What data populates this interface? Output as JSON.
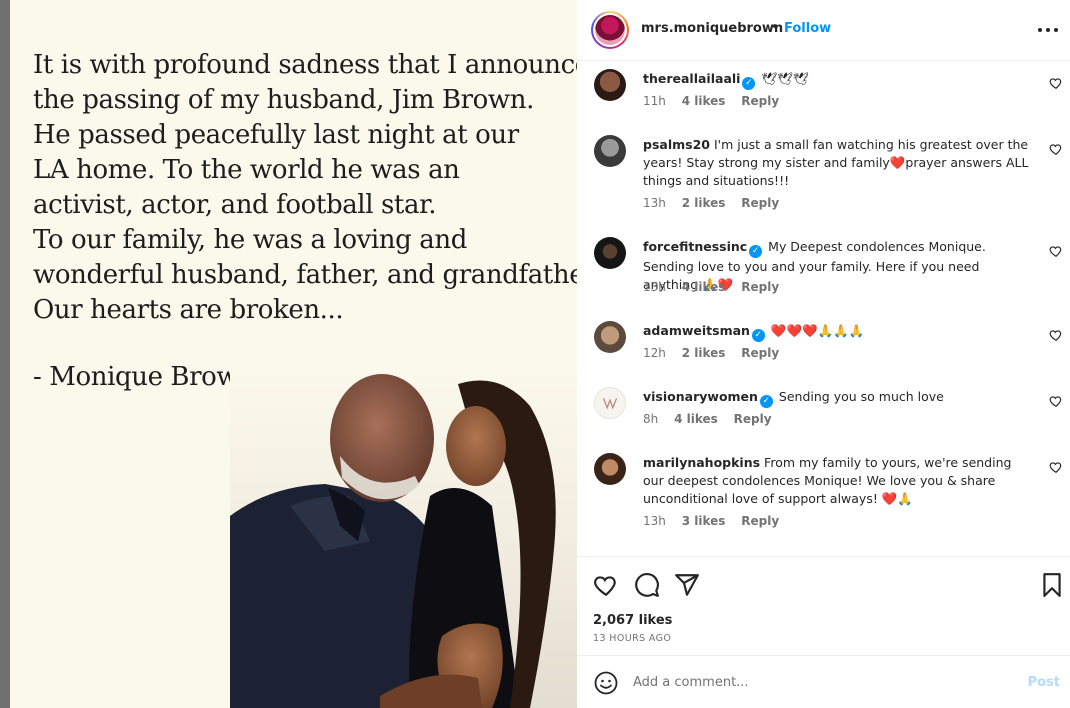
{
  "post": {
    "announcement_lines": [
      "It is with profound sadness that I announce",
      "the passing of my husband, Jim Brown.",
      "He passed peacefully last night at our",
      "LA home. To the world he was an",
      "activist, actor, and football star.",
      "To our family, he was a loving and",
      "wonderful husband, father, and grandfather.",
      "Our hearts are broken..."
    ],
    "signature": "- Monique Brown"
  },
  "header": {
    "username": "mrs.moniquebrown",
    "separator": "•",
    "follow_label": "Follow"
  },
  "comments": [
    {
      "user": "thereallailaali",
      "verified": true,
      "text": "🕊🕊🕊",
      "time": "11h",
      "likes": "4 likes",
      "reply": "Reply"
    },
    {
      "user": "psalms20",
      "verified": false,
      "text": "I'm just a small fan watching his greatest over the years! Stay strong my sister and family❤️prayer answers ALL things and situations!!!",
      "time": "13h",
      "likes": "2 likes",
      "reply": "Reply"
    },
    {
      "user": "forcefitnessinc",
      "verified": true,
      "text": "My Deepest condolences Monique. Sending love to you and your family. Here if you need anything 🙏❤️",
      "time": "13h",
      "likes": "4 likes",
      "reply": "Reply"
    },
    {
      "user": "adamweitsman",
      "verified": true,
      "text": "❤️❤️❤️🙏🙏🙏",
      "time": "12h",
      "likes": "2 likes",
      "reply": "Reply"
    },
    {
      "user": "visionarywomen",
      "verified": true,
      "text": "Sending you so much love",
      "time": "8h",
      "likes": "4 likes",
      "reply": "Reply"
    },
    {
      "user": "marilynahopkins",
      "verified": false,
      "text": "From my family to yours, we're sending our deepest condolences Monique! We love you & share unconditional love of support always! ❤️🙏",
      "time": "13h",
      "likes": "3 likes",
      "reply": "Reply"
    }
  ],
  "actions": {
    "likes": "2,067 likes",
    "time": "13 HOURS AGO"
  },
  "add_comment": {
    "placeholder": "Add a comment...",
    "post_label": "Post"
  },
  "colors": {
    "accent": "#0095f6",
    "post_disabled": "#b3dbff",
    "announcement_bg": "#fbf8ec"
  }
}
